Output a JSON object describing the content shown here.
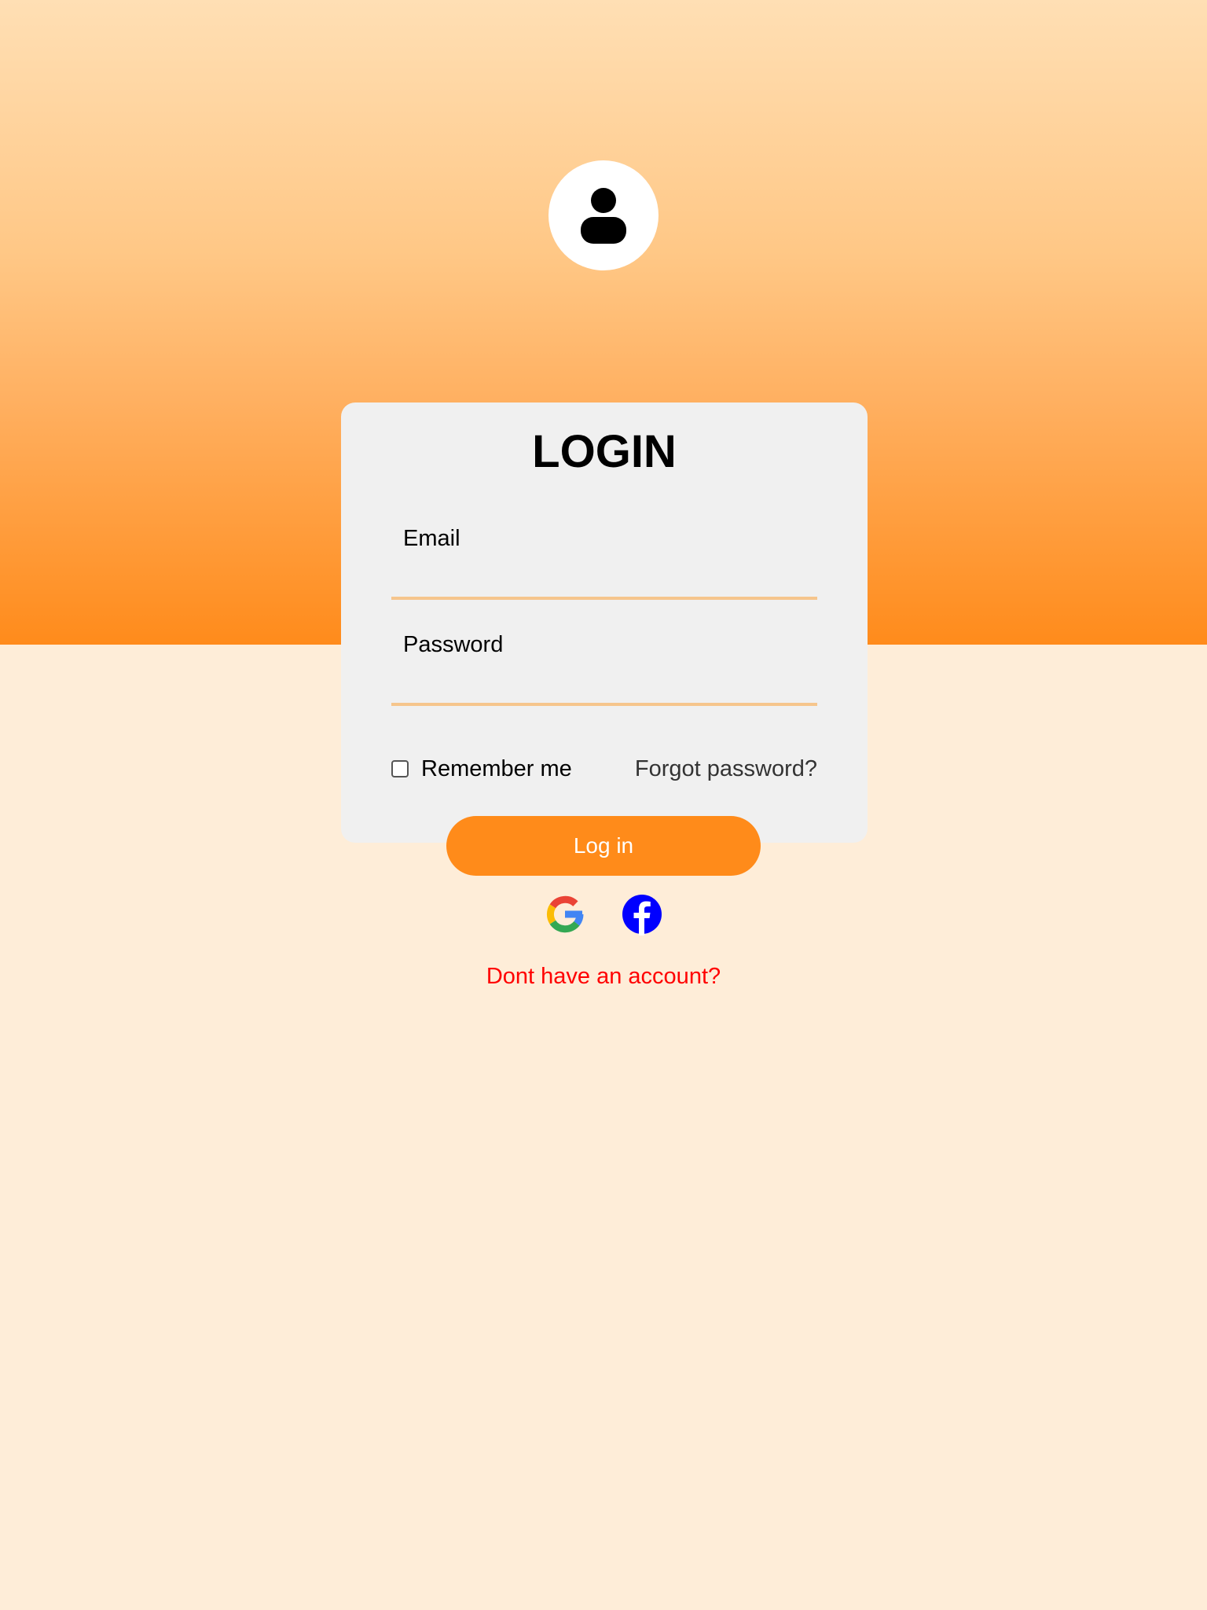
{
  "colors": {
    "accent": "#ff8b1a",
    "background": "#feedd8",
    "card": "#f0f0f0",
    "input_underline": "#f6c58c",
    "signup_link": "#ff0000",
    "facebook": "#0000ff"
  },
  "header": {
    "avatar_icon": "user-icon"
  },
  "login_card": {
    "title": "LOGIN",
    "email": {
      "label": "Email",
      "value": "",
      "placeholder": ""
    },
    "password": {
      "label": "Password",
      "value": "",
      "placeholder": ""
    },
    "remember_me": {
      "label": "Remember me",
      "checked": false
    },
    "forgot_password": "Forgot password?",
    "login_button": "Log in"
  },
  "social": [
    {
      "name": "google",
      "icon": "google-icon"
    },
    {
      "name": "facebook",
      "icon": "facebook-icon"
    }
  ],
  "signup_link": "Dont have an account?"
}
